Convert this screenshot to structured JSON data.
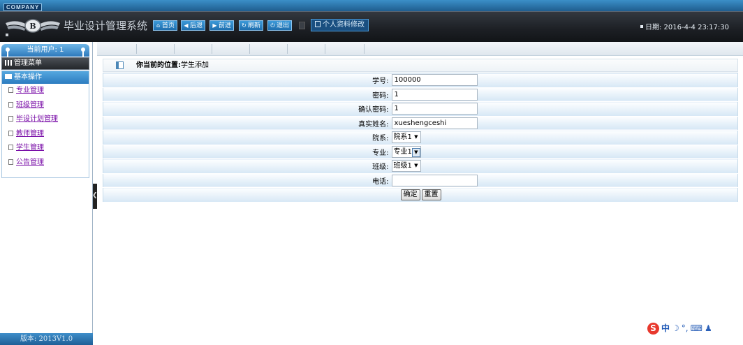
{
  "header": {
    "company_label": "COMPANY",
    "system_title": "毕业设计管理系统",
    "nav": [
      {
        "label": "首页",
        "icon": "home-icon"
      },
      {
        "label": "后退",
        "icon": "arrow-left-icon"
      },
      {
        "label": "前进",
        "icon": "arrow-right-icon"
      },
      {
        "label": "刷新",
        "icon": "refresh-icon"
      },
      {
        "label": "退出",
        "icon": "power-icon"
      }
    ],
    "profile_button": "个人资料修改",
    "date_label": "日期:",
    "date_value": "2016-4-4 23:17:30"
  },
  "sidebar": {
    "current_user": "当前用户: 1",
    "menu_title": "管理菜单",
    "section_title": "基本操作",
    "items": [
      {
        "label": "专业管理"
      },
      {
        "label": "班级管理"
      },
      {
        "label": "毕设计划管理"
      },
      {
        "label": "教师管理"
      },
      {
        "label": "学生管理"
      },
      {
        "label": "公告管理"
      }
    ],
    "version": "版本: 2013V1.0"
  },
  "breadcrumb": {
    "label": "你当前的位置:",
    "value": "学生添加"
  },
  "form": {
    "student_id_label": "学号:",
    "student_id_value": "100000",
    "password_label": "密码:",
    "password_value": "1",
    "confirm_password_label": "确认密码:",
    "confirm_password_value": "1",
    "real_name_label": "真实姓名:",
    "real_name_value": "xueshengceshi",
    "department_label": "院系:",
    "department_value": "院系1",
    "major_label": "专业:",
    "major_value": "专业1",
    "class_label": "班级:",
    "class_value": "班级1",
    "phone_label": "电话:",
    "phone_value": "",
    "submit_label": "确定",
    "reset_label": "重置"
  },
  "ime_tray": {
    "lang": "中"
  },
  "colors": {
    "header_bg": "#1a1d22",
    "nav_button": "#2a84c6",
    "form_row_gradient_bottom": "#d6e7f5",
    "menu_link": "#7a0fa8"
  }
}
